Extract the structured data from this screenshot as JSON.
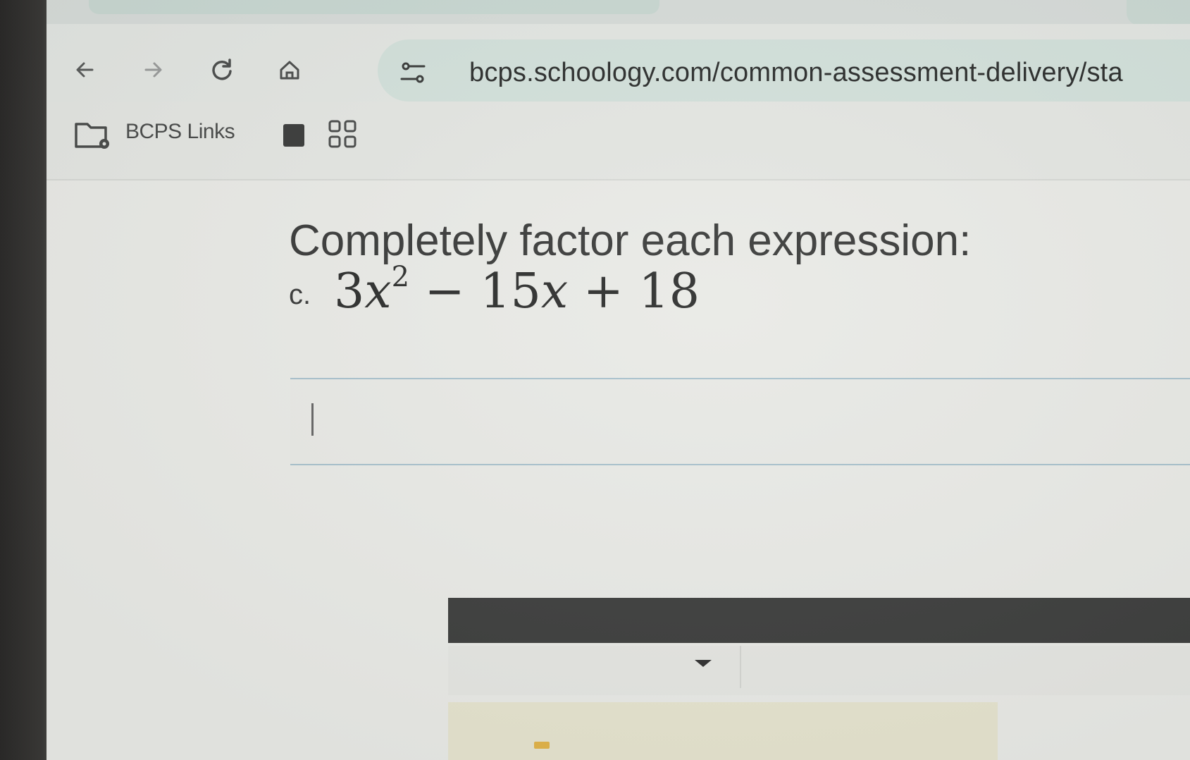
{
  "browser": {
    "url": "bcps.schoology.com/common-assessment-delivery/sta",
    "nav_icons": [
      "back-arrow-icon",
      "forward-arrow-icon",
      "reload-icon",
      "home-icon"
    ],
    "site_info_icon": "tune-icon"
  },
  "bookmarks_bar": {
    "folder_label": "BCPS Links",
    "folder_icon": "managed-folder-icon",
    "extra_icons": [
      "bookmark-square-icon",
      "apps-grid-icon"
    ]
  },
  "assessment": {
    "prompt": "Completely factor each expression:",
    "item_letter": "c.",
    "expression": {
      "term1_coef": "3",
      "term1_var": "x",
      "term1_exp": "2",
      "op1": "−",
      "term2_coef": "15",
      "term2_var": "x",
      "op2": "+",
      "term3": "18"
    },
    "answer_value": ""
  },
  "colors": {
    "omnibox_bg": "#d3e1db",
    "answer_border": "#a8c1cc",
    "dark_bar": "#3f403f"
  }
}
